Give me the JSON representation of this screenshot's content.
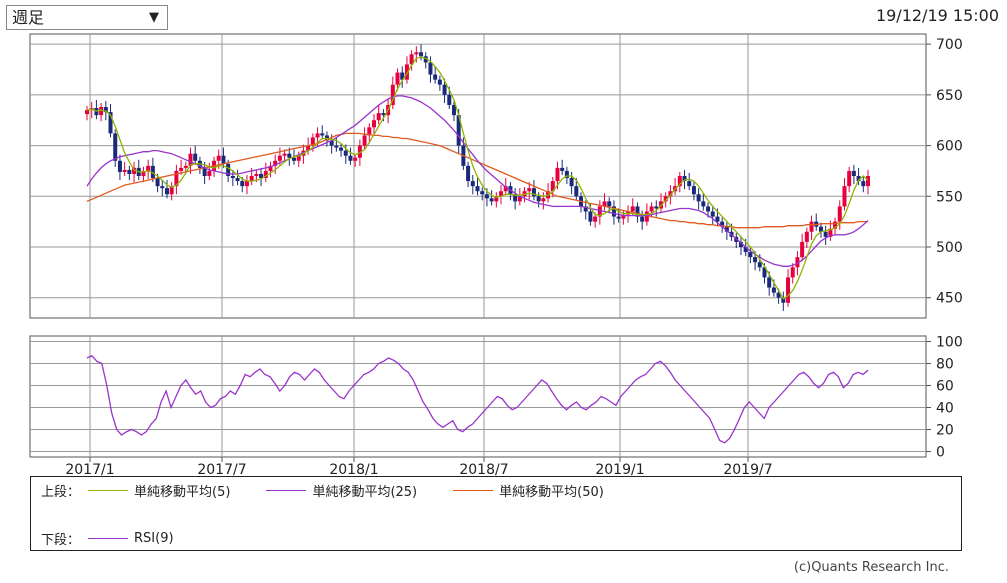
{
  "period_select": {
    "value": "週足"
  },
  "timestamp": "19/12/19 15:00",
  "legend": {
    "upper_label": "上段：",
    "lower_label": "下段：",
    "upper_items": [
      {
        "label": "単純移動平均(5)",
        "color": "#8db600"
      },
      {
        "label": "単純移動平均(25)",
        "color": "#9933cc"
      },
      {
        "label": "単純移動平均(50)",
        "color": "#e05a1e"
      }
    ],
    "lower_items": [
      {
        "label": "RSI(9)",
        "color": "#9933cc"
      }
    ]
  },
  "credit": "(c)Quants Research Inc.",
  "chart_data": {
    "type": "candlestick",
    "x_tick_labels": [
      "2017/1",
      "2017/7",
      "2018/1",
      "2018/7",
      "2019/1",
      "2019/7"
    ],
    "price_axis": {
      "ylim": [
        430,
        710
      ],
      "ticks": [
        450,
        500,
        550,
        600,
        650,
        700
      ],
      "position": "right"
    },
    "rsi_axis": {
      "ylim": [
        -5,
        105
      ],
      "ticks": [
        0,
        20,
        40,
        60,
        80,
        100
      ],
      "position": "right"
    },
    "grid": true,
    "up_color": "#e8003c",
    "down_color": "#1a2a7a",
    "close_approx": [
      635,
      637,
      630,
      638,
      633,
      612,
      585,
      574,
      576,
      572,
      578,
      570,
      575,
      580,
      568,
      560,
      558,
      552,
      560,
      575,
      578,
      580,
      592,
      585,
      578,
      570,
      575,
      585,
      590,
      582,
      570,
      568,
      565,
      560,
      565,
      570,
      572,
      568,
      575,
      580,
      585,
      590,
      592,
      588,
      585,
      590,
      595,
      600,
      608,
      612,
      610,
      605,
      600,
      598,
      595,
      590,
      585,
      588,
      600,
      610,
      618,
      625,
      632,
      630,
      640,
      660,
      672,
      665,
      680,
      690,
      692,
      688,
      682,
      670,
      665,
      660,
      650,
      640,
      630,
      600,
      580,
      565,
      560,
      555,
      552,
      548,
      545,
      550,
      555,
      560,
      552,
      545,
      550,
      555,
      558,
      550,
      545,
      548,
      555,
      565,
      578,
      575,
      568,
      560,
      550,
      540,
      535,
      525,
      530,
      540,
      545,
      540,
      530,
      528,
      532,
      535,
      540,
      530,
      525,
      535,
      540,
      538,
      545,
      550,
      555,
      560,
      570,
      565,
      560,
      552,
      545,
      540,
      535,
      530,
      525,
      520,
      515,
      510,
      505,
      500,
      495,
      490,
      485,
      480,
      470,
      460,
      455,
      450,
      445,
      470,
      480,
      490,
      505,
      515,
      525,
      520,
      515,
      510,
      518,
      525,
      540,
      560,
      575,
      570,
      565,
      560,
      570
    ],
    "sma5_approx": [
      635,
      636,
      634,
      635,
      634,
      630,
      619,
      606,
      593,
      584,
      576,
      574,
      574,
      575,
      573,
      570,
      566,
      561,
      559,
      561,
      566,
      573,
      581,
      582,
      582,
      581,
      579,
      578,
      580,
      580,
      578,
      575,
      571,
      567,
      565,
      565,
      566,
      567,
      570,
      573,
      576,
      580,
      584,
      587,
      589,
      590,
      592,
      595,
      598,
      603,
      607,
      607,
      606,
      605,
      602,
      597,
      593,
      591,
      593,
      596,
      603,
      611,
      619,
      627,
      635,
      645,
      656,
      664,
      671,
      679,
      686,
      687,
      686,
      683,
      678,
      672,
      664,
      655,
      645,
      630,
      612,
      595,
      580,
      569,
      561,
      555,
      551,
      549,
      550,
      552,
      552,
      551,
      551,
      552,
      553,
      552,
      551,
      550,
      551,
      555,
      561,
      567,
      570,
      570,
      566,
      558,
      548,
      539,
      532,
      531,
      533,
      536,
      538,
      535,
      533,
      533,
      533,
      532,
      532,
      532,
      533,
      536,
      541,
      546,
      551,
      557,
      562,
      566,
      567,
      565,
      560,
      553,
      546,
      540,
      535,
      530,
      525,
      520,
      515,
      510,
      505,
      500,
      494,
      488,
      481,
      473,
      465,
      457,
      449,
      452,
      457,
      466,
      477,
      490,
      503,
      511,
      515,
      516,
      517,
      519,
      523,
      531,
      543,
      556,
      566,
      570,
      566
    ],
    "sma25_approx": [
      560,
      567,
      573,
      578,
      582,
      585,
      587,
      589,
      590,
      591,
      592,
      593,
      594,
      594,
      595,
      595,
      594,
      593,
      592,
      590,
      588,
      586,
      584,
      582,
      580,
      578,
      576,
      575,
      574,
      573,
      572,
      572,
      572,
      573,
      574,
      575,
      576,
      577,
      578,
      579,
      581,
      583,
      585,
      587,
      589,
      591,
      593,
      595,
      597,
      599,
      601,
      603,
      605,
      608,
      611,
      614,
      617,
      620,
      624,
      628,
      632,
      636,
      640,
      643,
      646,
      648,
      649,
      649,
      648,
      647,
      645,
      643,
      640,
      637,
      633,
      629,
      625,
      620,
      615,
      609,
      603,
      597,
      591,
      585,
      580,
      575,
      571,
      567,
      563,
      559,
      556,
      553,
      550,
      548,
      546,
      544,
      543,
      542,
      541,
      540,
      540,
      540,
      540,
      540,
      540,
      540,
      539,
      538,
      537,
      536,
      535,
      534,
      533,
      532,
      531,
      531,
      531,
      531,
      531,
      531,
      532,
      533,
      534,
      535,
      536,
      537,
      538,
      538,
      538,
      537,
      536,
      534,
      531,
      528,
      524,
      520,
      516,
      512,
      508,
      504,
      500,
      496,
      493,
      490,
      487,
      485,
      483,
      482,
      481,
      481,
      482,
      484,
      487,
      491,
      496,
      501,
      506,
      509,
      511,
      512,
      512,
      512,
      513,
      515,
      518,
      522,
      526
    ],
    "sma50_approx": [
      545,
      547,
      549,
      551,
      553,
      555,
      557,
      559,
      561,
      562,
      563,
      564,
      565,
      566,
      567,
      568,
      569,
      570,
      571,
      572,
      573,
      574,
      575,
      576,
      577,
      578,
      579,
      580,
      581,
      582,
      583,
      584,
      585,
      586,
      587,
      588,
      589,
      590,
      591,
      592,
      593,
      594,
      595,
      596,
      597,
      598,
      599,
      600,
      601,
      602,
      604,
      606,
      608,
      610,
      611,
      612,
      612,
      612,
      612,
      611,
      611,
      610,
      610,
      609,
      609,
      608,
      608,
      607,
      607,
      606,
      605,
      604,
      603,
      602,
      601,
      600,
      598,
      596,
      594,
      592,
      590,
      588,
      586,
      584,
      582,
      580,
      578,
      576,
      574,
      572,
      570,
      568,
      566,
      564,
      562,
      560,
      558,
      556,
      554,
      552,
      550,
      549,
      548,
      547,
      546,
      545,
      544,
      543,
      542,
      541,
      540,
      539,
      538,
      537,
      536,
      535,
      534,
      533,
      532,
      531,
      530,
      529,
      528,
      527,
      526,
      526,
      525,
      525,
      524,
      524,
      523,
      523,
      522,
      522,
      521,
      521,
      520,
      520,
      519,
      519,
      519,
      519,
      519,
      519,
      520,
      520,
      520,
      520,
      520,
      521,
      521,
      521,
      521,
      522,
      522,
      522,
      523,
      523,
      523,
      523,
      524,
      524,
      524,
      524,
      525,
      525,
      525
    ],
    "rsi_approx": [
      85,
      87,
      82,
      80,
      60,
      35,
      20,
      15,
      18,
      20,
      18,
      15,
      18,
      25,
      30,
      45,
      55,
      40,
      50,
      60,
      65,
      58,
      52,
      55,
      45,
      40,
      42,
      48,
      50,
      55,
      52,
      60,
      70,
      68,
      72,
      75,
      70,
      68,
      62,
      55,
      60,
      68,
      72,
      70,
      65,
      70,
      75,
      72,
      65,
      60,
      55,
      50,
      48,
      55,
      60,
      65,
      70,
      72,
      75,
      80,
      82,
      85,
      83,
      80,
      75,
      72,
      65,
      55,
      45,
      38,
      30,
      25,
      22,
      25,
      28,
      20,
      18,
      22,
      25,
      30,
      35,
      40,
      45,
      50,
      48,
      42,
      38,
      40,
      45,
      50,
      55,
      60,
      65,
      62,
      55,
      48,
      42,
      38,
      42,
      45,
      40,
      38,
      42,
      45,
      50,
      48,
      45,
      42,
      50,
      55,
      60,
      65,
      68,
      70,
      75,
      80,
      82,
      78,
      72,
      65,
      60,
      55,
      50,
      45,
      40,
      35,
      30,
      20,
      10,
      8,
      12,
      20,
      30,
      40,
      45,
      40,
      35,
      30,
      40,
      45,
      50,
      55,
      60,
      65,
      70,
      72,
      68,
      62,
      58,
      62,
      70,
      72,
      68,
      58,
      62,
      70,
      72,
      70,
      74
    ]
  }
}
